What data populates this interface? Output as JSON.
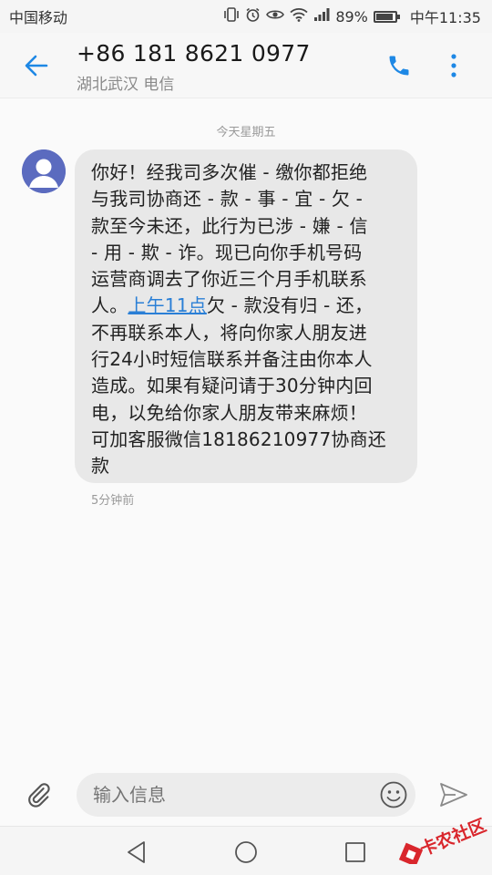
{
  "status_bar": {
    "carrier": "中国移动",
    "battery": "89%",
    "battery_level": 0.89,
    "time": "中午11:35",
    "icons": [
      "vibrate-icon",
      "alarm-icon",
      "eye-icon",
      "wifi-icon",
      "signal-icon",
      "battery-icon"
    ]
  },
  "header": {
    "back_icon": "arrow-left-icon",
    "title": "+86 181 8621 0977",
    "subtitle": "湖北武汉 电信",
    "call_icon": "phone-icon",
    "more_icon": "more-vertical-icon",
    "accent_color": "#1e88e5"
  },
  "conversation": {
    "date_divider": "今天星期五",
    "message": {
      "lines": [
        "你好！经我司多次催 - 缴你都拒绝",
        "与我司协商还 - 款 - 事 - 宜 - 欠 -",
        "款至今未还，此行为已涉 - 嫌 - 信",
        "- 用 - 欺 - 诈。现已向你手机号码",
        "运营商调去了你近三个月手机联系",
        "",
        "不再联系本人，将向你家人朋友进",
        "行24小时短信联系并备注由你本人",
        "造成。如果有疑问请于30分钟内回",
        "电，以免给你家人朋友带来麻烦！",
        "可加客服微信18186210977协商还",
        "款"
      ],
      "line6_pre": "人。",
      "line6_link": "上午11点",
      "line6_post": "欠 - 款没有归 - 还，",
      "time_ago": "5分钟前"
    }
  },
  "composer": {
    "attach_icon": "paperclip-icon",
    "placeholder": "输入信息",
    "emoji_icon": "smiley-icon",
    "send_icon": "send-icon"
  },
  "nav_bar": {
    "icons": [
      "nav-back-icon",
      "nav-home-icon",
      "nav-recent-icon"
    ]
  },
  "watermark": {
    "text": "卡农社区"
  }
}
